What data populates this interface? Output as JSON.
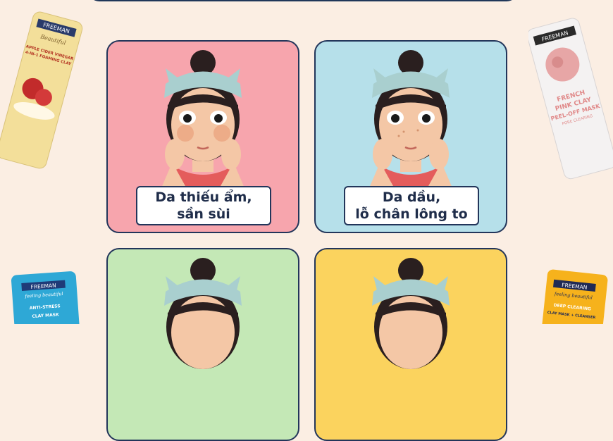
{
  "cards": [
    {
      "line1": "Da thiếu ẩm,",
      "line2": "sần sùi",
      "bg": "#f7a5ad"
    },
    {
      "line1": "Da dầu,",
      "line2": "lỗ chân lông to",
      "bg": "#b6e0ea"
    },
    {
      "line1": "",
      "line2": "",
      "bg": "#c4e8b6"
    },
    {
      "line1": "",
      "line2": "",
      "bg": "#fbd35e"
    }
  ],
  "products": {
    "apple": {
      "brand": "FREEMAN",
      "script": "Beautiful",
      "name1": "APPLE CIDER VINEGAR",
      "name2": "4-IN-1 FOAMING CLAY"
    },
    "pink": {
      "brand": "FREEMAN",
      "name1": "FRENCH",
      "name2": "PINK CLAY",
      "name3": "PEEL-OFF MASK",
      "name4": "PORE CLEARING"
    },
    "blue": {
      "brand": "FREEMAN",
      "script": "feeling beautiful",
      "name1": "ANTI-STRESS",
      "name2": "CLAY MASK"
    },
    "yellow": {
      "brand": "FREEMAN",
      "script": "feeling beautiful",
      "name1": "DEEP CLEARING",
      "name2": "CLAY MASK + CLEANSER"
    }
  },
  "colors": {
    "navy": "#22355a",
    "page_bg": "#fbeee3"
  }
}
